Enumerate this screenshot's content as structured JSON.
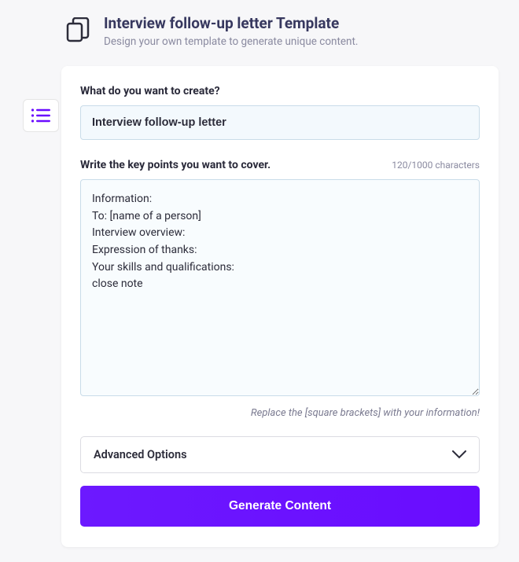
{
  "header": {
    "title": "Interview follow-up letter Template",
    "subtitle": "Design your own template to generate unique content."
  },
  "form": {
    "create_label": "What do you want to create?",
    "create_value": "Interview follow-up letter",
    "keypoints_label": "Write the key points you want to cover.",
    "char_count": "120/1000 characters",
    "keypoints_value": "Information:\nTo: [name of a person]\nInterview overview:\nExpression of thanks:\nYour skills and qualifications:\nclose note",
    "hint": "Replace the [square brackets] with your information!",
    "advanced_label": "Advanced Options",
    "generate_label": "Generate Content"
  },
  "colors": {
    "accent": "#6a0cff",
    "muted": "#8a8aa0",
    "text": "#2c2c3a"
  }
}
